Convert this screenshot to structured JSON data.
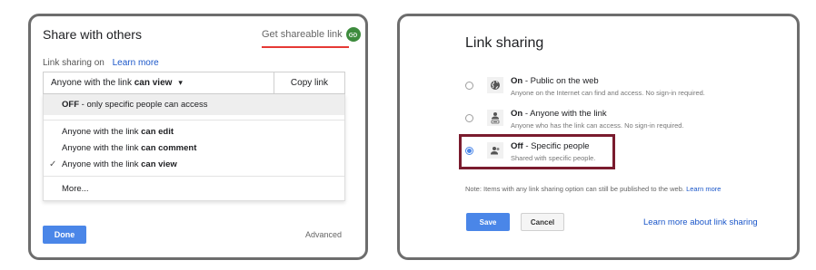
{
  "left_panel": {
    "title": "Share with others",
    "get_link_label": "Get shareable link",
    "link_sharing_status": "Link sharing on",
    "learn_more": "Learn more",
    "dropdown": {
      "prefix": "Anyone with the link ",
      "bold": "can view",
      "arrow": "▾",
      "copy_label": "Copy link"
    },
    "menu": {
      "off_bold": "OFF",
      "off_rest": " - only specific people can access",
      "items": [
        {
          "prefix": "Anyone with the link ",
          "bold": "can edit",
          "checked": false
        },
        {
          "prefix": "Anyone with the link ",
          "bold": "can comment",
          "checked": false
        },
        {
          "prefix": "Anyone with the link ",
          "bold": "can view",
          "checked": true
        }
      ],
      "check_glyph": "✓",
      "more": "More..."
    },
    "done_label": "Done",
    "advanced_label": "Advanced"
  },
  "right_panel": {
    "title": "Link sharing",
    "options": [
      {
        "bold": "On",
        "rest": " - Public on the web",
        "desc": "Anyone on the Internet can find and access. No sign-in required.",
        "icon": "globe-icon",
        "selected": false
      },
      {
        "bold": "On",
        "rest": " - Anyone with the link",
        "desc": "Anyone who has the link can access. No sign-in required.",
        "icon": "person-link-icon",
        "selected": false
      },
      {
        "bold": "Off",
        "rest": " - Specific people",
        "desc": "Shared with specific people.",
        "icon": "person-icon",
        "selected": true
      }
    ],
    "note_text": "Note: Items with any link sharing option can still be published to the web. ",
    "note_link": "Learn more",
    "save_label": "Save",
    "cancel_label": "Cancel",
    "learn_more_link": "Learn more about link sharing"
  },
  "colors": {
    "accent_blue": "#4a86e8",
    "link_blue": "#1a56c9",
    "link_icon_green": "#3d8b3d",
    "annotation_red": "#e53935",
    "highlight_maroon": "#7a1b2e"
  }
}
